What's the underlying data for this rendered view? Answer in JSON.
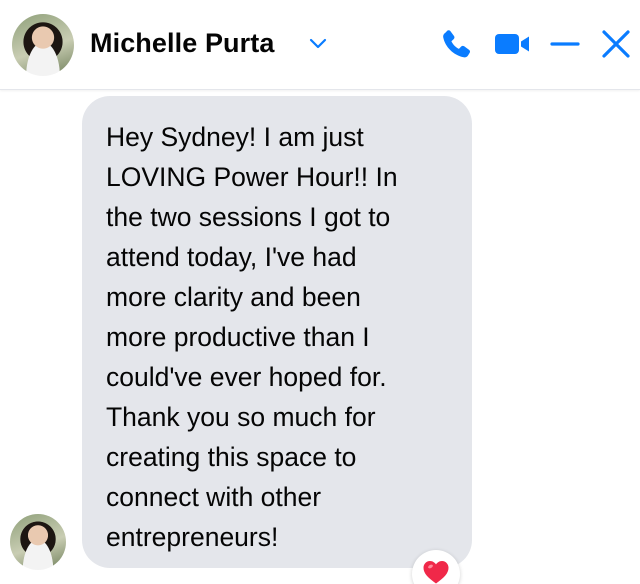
{
  "header": {
    "contact_name": "Michelle Purta",
    "accent_color": "#0a7cff",
    "icons": [
      "chevron-down-icon",
      "phone-icon",
      "video-camera-icon",
      "minimize-icon",
      "close-icon"
    ]
  },
  "conversation": {
    "messages": [
      {
        "sender": "Michelle Purta",
        "text": "Hey Sydney! I am just\nLOVING Power Hour!! In\nthe two sessions I got to\nattend today, I've had\nmore clarity and been\nmore productive than I\ncould've ever hoped for.\nThank you so much for\ncreating this space to\nconnect with other\nentrepreneurs!",
        "reaction": "heart-icon",
        "reaction_color": "#f02849",
        "bubble_color": "#e4e6eb"
      }
    ]
  }
}
